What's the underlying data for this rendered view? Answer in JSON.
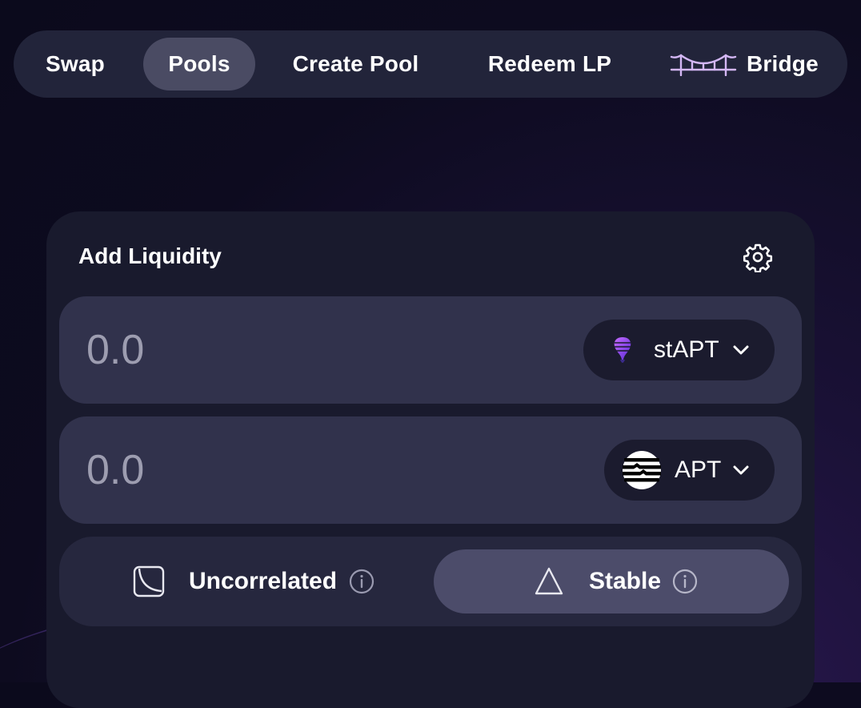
{
  "nav": {
    "items": [
      {
        "label": "Swap",
        "active": false
      },
      {
        "label": "Pools",
        "active": true
      },
      {
        "label": "Create Pool",
        "active": false
      },
      {
        "label": "Redeem LP",
        "active": false
      },
      {
        "label": "Bridge",
        "active": false,
        "icon": "bridge-icon"
      }
    ]
  },
  "card": {
    "title": "Add Liquidity",
    "settings_icon": "gear-icon"
  },
  "inputs": [
    {
      "value": "",
      "placeholder": "0.0",
      "token": "stAPT",
      "token_icon": "stapt-token-icon"
    },
    {
      "value": "",
      "placeholder": "0.0",
      "token": "APT",
      "token_icon": "apt-token-icon"
    }
  ],
  "curves": [
    {
      "label": "Uncorrelated",
      "icon": "uncorrelated-curve-icon",
      "selected": false
    },
    {
      "label": "Stable",
      "icon": "stable-triangle-icon",
      "selected": true
    }
  ],
  "colors": {
    "nav_bg": "#22243a",
    "nav_active": "#4a4b63",
    "card_bg": "#191a2d",
    "input_bg": "#31324c",
    "selected_bg": "#4c4c6a",
    "accent_purple": "#c9a8ff"
  }
}
